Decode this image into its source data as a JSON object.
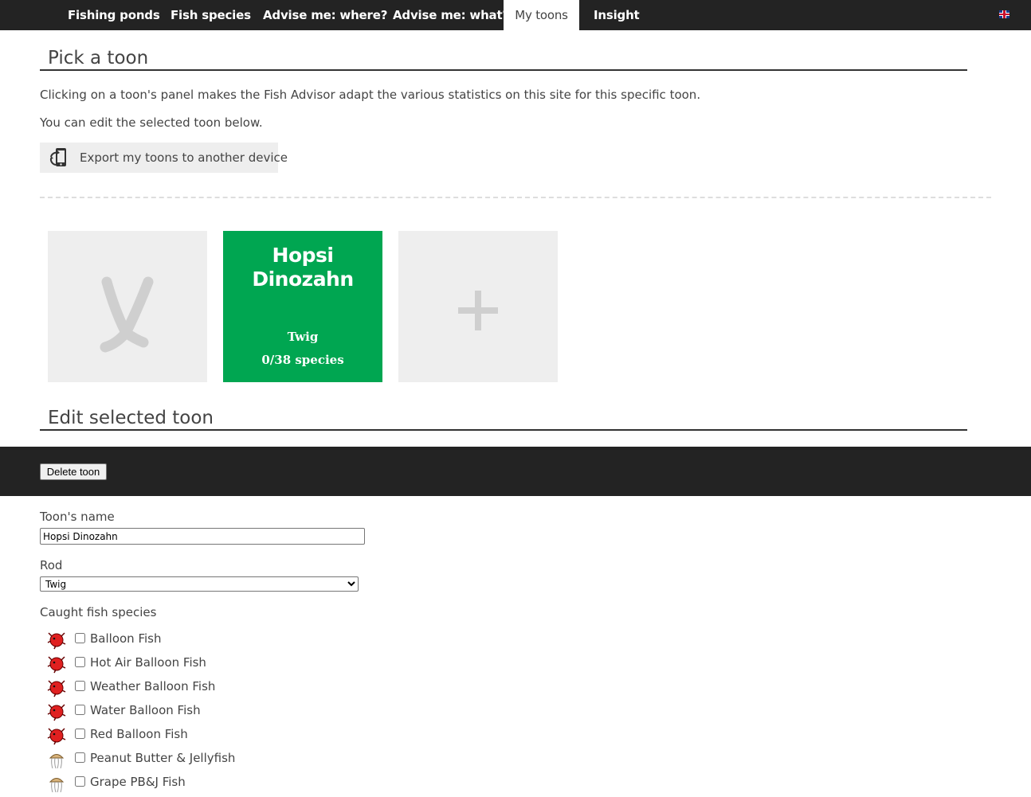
{
  "nav": {
    "tabs": [
      {
        "label": "Fishing ponds",
        "active": false
      },
      {
        "label": "Fish species",
        "active": false
      },
      {
        "label": "Advise me: where?",
        "active": false
      },
      {
        "label": "Advise me: what?",
        "active": false
      },
      {
        "label": "My toons",
        "active": true
      },
      {
        "label": "Insight",
        "active": false
      }
    ],
    "language_icon": "uk-flag-icon"
  },
  "pick": {
    "title": "Pick a toon",
    "intro": "Clicking on a toon's panel makes the Fish Advisor adapt the various statistics on this site for this specific toon.",
    "edit_hint": "You can edit the selected toon below.",
    "export_label": "Export my toons to another device",
    "export_icon": "phone-transfer-icon"
  },
  "toons": {
    "remove_icon": "x-icon",
    "selected": {
      "name": "Hopsi Dinozahn",
      "rod": "Twig",
      "species_count": "0/38 species",
      "color": "#00a651"
    },
    "add_icon": "plus-icon"
  },
  "edit": {
    "title": "Edit selected toon",
    "delete_label": "Delete toon",
    "name_label": "Toon's name",
    "name_value": "Hopsi Dinozahn",
    "rod_label": "Rod",
    "rod_value": "Twig",
    "caught_label": "Caught fish species",
    "fish": [
      {
        "name": "Balloon Fish",
        "icon": "balloon-fish-icon",
        "checked": false
      },
      {
        "name": "Hot Air Balloon Fish",
        "icon": "balloon-fish-icon",
        "checked": false
      },
      {
        "name": "Weather Balloon Fish",
        "icon": "balloon-fish-icon",
        "checked": false
      },
      {
        "name": "Water Balloon Fish",
        "icon": "balloon-fish-icon",
        "checked": false
      },
      {
        "name": "Red Balloon Fish",
        "icon": "balloon-fish-icon",
        "checked": false
      },
      {
        "name": "Peanut Butter & Jellyfish",
        "icon": "jellyfish-icon",
        "checked": false
      },
      {
        "name": "Grape PB&J Fish",
        "icon": "jellyfish-icon",
        "checked": false
      }
    ]
  }
}
